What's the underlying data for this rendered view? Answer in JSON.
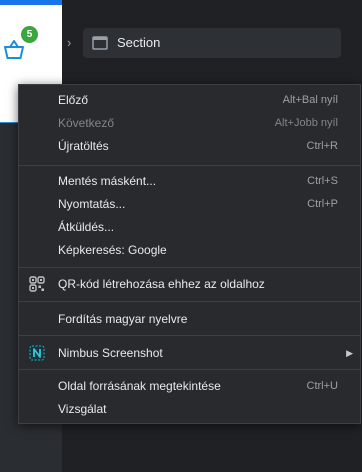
{
  "page": {
    "cart_count": "5"
  },
  "devtools": {
    "section_label": "Section"
  },
  "menu": {
    "groups": [
      [
        {
          "label": "Előző",
          "shortcut": "Alt+Bal nyíl",
          "enabled": true
        },
        {
          "label": "Következő",
          "shortcut": "Alt+Jobb nyíl",
          "enabled": false
        },
        {
          "label": "Újratöltés",
          "shortcut": "Ctrl+R",
          "enabled": true
        }
      ],
      [
        {
          "label": "Mentés másként...",
          "shortcut": "Ctrl+S",
          "enabled": true
        },
        {
          "label": "Nyomtatás...",
          "shortcut": "Ctrl+P",
          "enabled": true
        },
        {
          "label": "Átküldés...",
          "shortcut": "",
          "enabled": true
        },
        {
          "label": "Képkeresés: Google",
          "shortcut": "",
          "enabled": true
        }
      ],
      [
        {
          "label": "QR-kód létrehozása ehhez az oldalhoz",
          "icon": "qr-code-icon",
          "enabled": true
        }
      ],
      [
        {
          "label": "Fordítás magyar nyelvre",
          "enabled": true
        }
      ],
      [
        {
          "label": "Nimbus Screenshot",
          "icon": "nimbus-extension-icon",
          "submenu": true,
          "enabled": true
        }
      ],
      [
        {
          "label": "Oldal forrásának megtekintése",
          "shortcut": "Ctrl+U",
          "enabled": true
        },
        {
          "label": "Vizsgálat",
          "shortcut": "",
          "enabled": true
        }
      ]
    ]
  },
  "colors": {
    "badge": "#3ca53f",
    "accent": "#1a73e8",
    "menu_bg": "#292a2d"
  }
}
